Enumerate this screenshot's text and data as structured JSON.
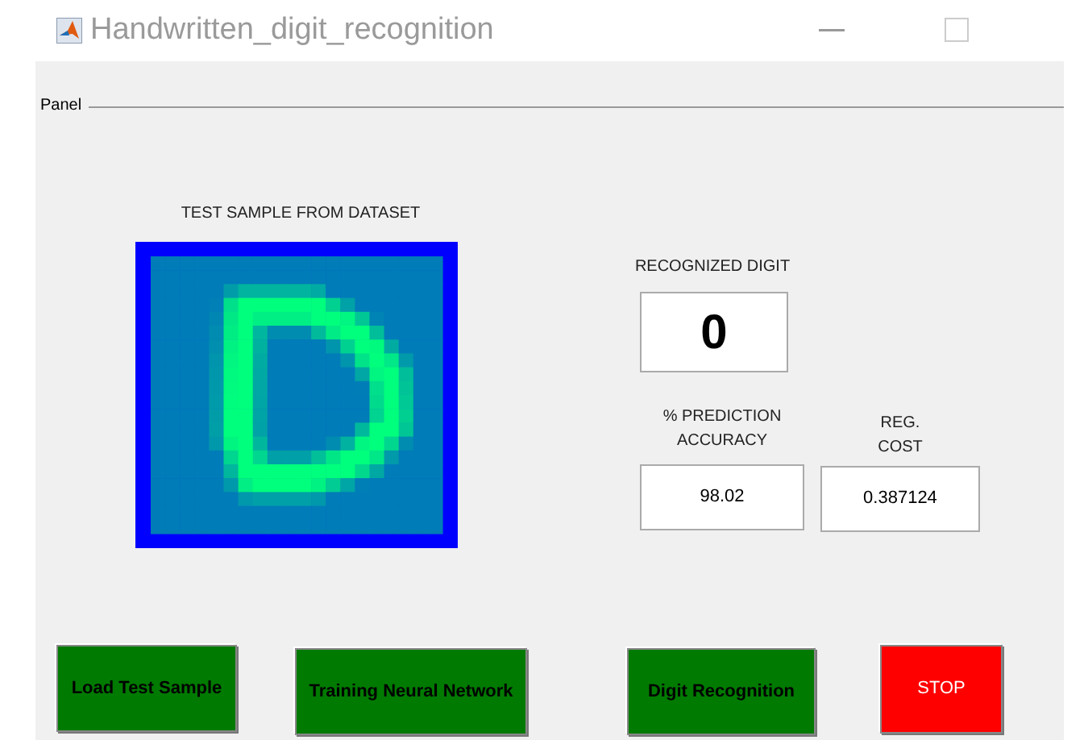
{
  "window": {
    "title": "Handwritten_digit_recognition"
  },
  "panel": {
    "title": "Panel",
    "sample": {
      "label": "TEST SAMPLE FROM DATASET"
    },
    "recognized": {
      "label": "RECOGNIZED DIGIT",
      "value": "0"
    },
    "accuracy": {
      "label": "% PREDICTION ACCURACY",
      "value": "98.02"
    },
    "cost": {
      "label": "REG. COST",
      "value": "0.387124"
    },
    "buttons": [
      {
        "label": "Load Test Sample",
        "kind": "action",
        "color": "#007a00"
      },
      {
        "label": "Training Neural Network",
        "kind": "action",
        "color": "#007a00"
      },
      {
        "label": "Digit Recognition",
        "kind": "action",
        "color": "#007a00"
      },
      {
        "label": "STOP",
        "kind": "stop",
        "color": "#ff0000"
      }
    ]
  }
}
